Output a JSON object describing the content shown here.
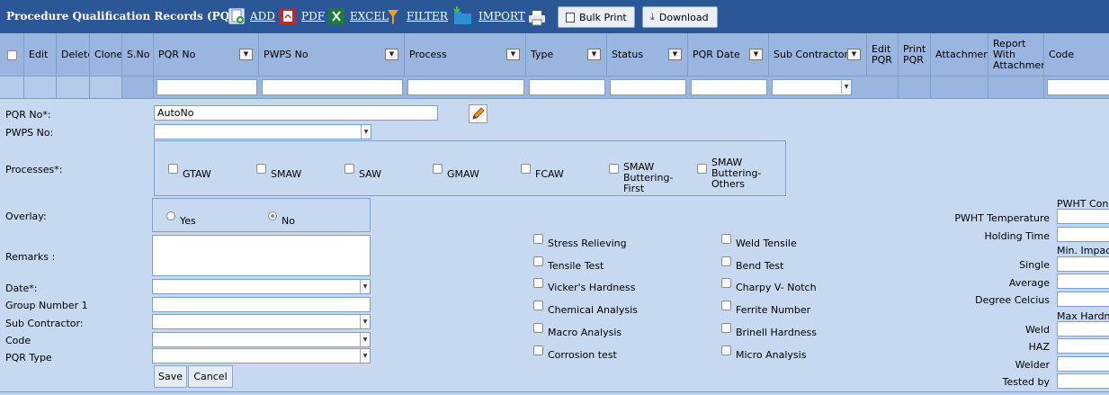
{
  "toolbar": {
    "title": "Procedure Qualification Records (PQR)",
    "add_label": "ADD",
    "pdf_label": "PDF",
    "excel_label": "EXCEL",
    "filter_label": "FILTER",
    "import_label": "IMPORT",
    "bulk_print_label": "Bulk Print",
    "download_label": "Download"
  },
  "grid": {
    "columns": {
      "edit": "Edit",
      "delete": "Delete",
      "clone": "Clone",
      "sno": "S.No",
      "pqr_no": "PQR No",
      "pwps_no": "PWPS No",
      "process": "Process",
      "type": "Type",
      "status": "Status",
      "pqr_date": "PQR Date",
      "sub_contractor": "Sub Contractor",
      "edit_pqr": "Edit PQR",
      "print_pqr": "Print PQR",
      "attachment": "Attachment",
      "report_with_attachment": "Report With Attachment",
      "code": "Code"
    }
  },
  "form": {
    "pqr_no_label": "PQR No*:",
    "pqr_no_value": "AutoNo",
    "pwps_no_label": "PWPS No:",
    "processes_label": "Processes*:",
    "processes": {
      "gtaw": "GTAW",
      "smaw": "SMAW",
      "saw": "SAW",
      "gmaw": "GMAW",
      "fcaw": "FCAW",
      "smaw_bf": "SMAW Buttering-First",
      "smaw_bo": "SMAW Buttering-Others"
    },
    "overlay_label": "Overlay:",
    "overlay_yes": "Yes",
    "overlay_no": "No",
    "overlay_selected": "No",
    "remarks_label": "Remarks :",
    "date_label": "Date*:",
    "group_number_label": "Group Number 1",
    "sub_contractor_label": "Sub Contractor:",
    "code_label": "Code",
    "pqr_type_label": "PQR Type",
    "save_label": "Save",
    "cancel_label": "Cancel"
  },
  "tests": {
    "stress_relieving": "Stress Relieving",
    "tensile_test": "Tensile Test",
    "vickers_hardness": "Vicker's Hardness",
    "chemical_analysis": "Chemical Analysis",
    "macro_analysis": "Macro Analysis",
    "corrosion_test": "Corrosion test",
    "weld_tensile": "Weld Tensile",
    "bend_test": "Bend Test",
    "charpy_v_notch": "Charpy V- Notch",
    "ferrite_number": "Ferrite Number",
    "brinell_hardness": "Brinell Hardness",
    "micro_analysis": "Micro Analysis"
  },
  "right_panel": {
    "pwht_cond_header": "PWHT Cond",
    "pwht_temperature": "PWHT Temperature",
    "holding_time": "Holding Time",
    "min_impact_header": "Min. Impact",
    "single": "Single",
    "average": "Average",
    "degree_celcius": "Degree Celcius",
    "max_hardness_header": "Max Hardne",
    "weld": "Weld",
    "haz": "HAZ",
    "welder": "Welder",
    "tested_by": "Tested by"
  },
  "icons": {
    "add": "add-document-icon",
    "pdf": "pdf-icon",
    "excel": "excel-icon",
    "filter": "filter-icon",
    "import": "import-icon",
    "print": "printer-icon",
    "bulk_print": "printer-small-icon",
    "download": "download-icon",
    "edit_pencil": "pencil-icon"
  },
  "colors": {
    "toolbar_bg": "#2b5797",
    "header_bg": "#9ab6e0",
    "body_bg": "#c6d9f1",
    "excel_green": "#1e7a3c",
    "pdf_red": "#c0282d",
    "filter_orange": "#f0a020"
  }
}
